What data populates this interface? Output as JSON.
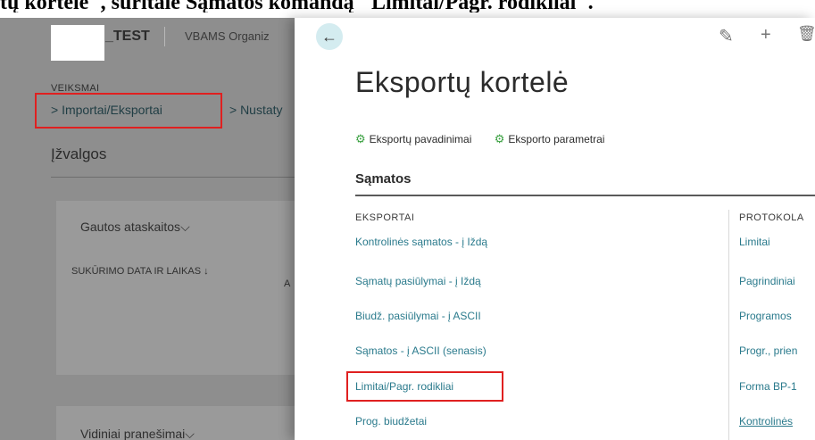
{
  "caption": "tų kortelė\", suritalė Sąmatos komandą \"Limitai/Pagr. rodikliai\".",
  "left": {
    "company": "_TEST",
    "org": "VBAMS Organiz",
    "veiksmai": "VEIKSMAI",
    "actions": [
      "> Importai/Eksportai",
      "> Nustaty"
    ],
    "izvalgos": "Įžvalgos",
    "card1_title": "Gautos ataskaitos",
    "col_header": "SUKŪRIMO DATA IR LAIKAS ↓",
    "col_a": "A",
    "card2_title": "Vidiniai pranešimai"
  },
  "right": {
    "back_icon": "←",
    "edit_icon": "✎",
    "add_icon": "+",
    "delete_icon": "🗑",
    "title": "Eksportų kortelė",
    "actions": [
      "Eksportų pavadinimai",
      "Eksporto parametrai"
    ],
    "section": "Sąmatos",
    "group1": {
      "header": "EKSPORTAI",
      "links": [
        "Kontrolinės sąmatos - į Iždą",
        "Sąmatų pasiūlymai - į Iždą",
        "Biudž. pasiūlymai - į ASCII",
        "Sąmatos - į ASCII (senasis)",
        "Limitai/Pagr. rodikliai",
        "Prog. biudžetai"
      ]
    },
    "group2": {
      "header": "PROTOKOLA",
      "links": [
        "Limitai",
        "Pagrindiniai",
        "Programos",
        "Progr., prien",
        "Forma BP-1",
        "Kontrolinės"
      ]
    }
  },
  "colors": {
    "highlight": "#e02020",
    "link": "#2a7a8c",
    "gear": "#3aa040"
  }
}
